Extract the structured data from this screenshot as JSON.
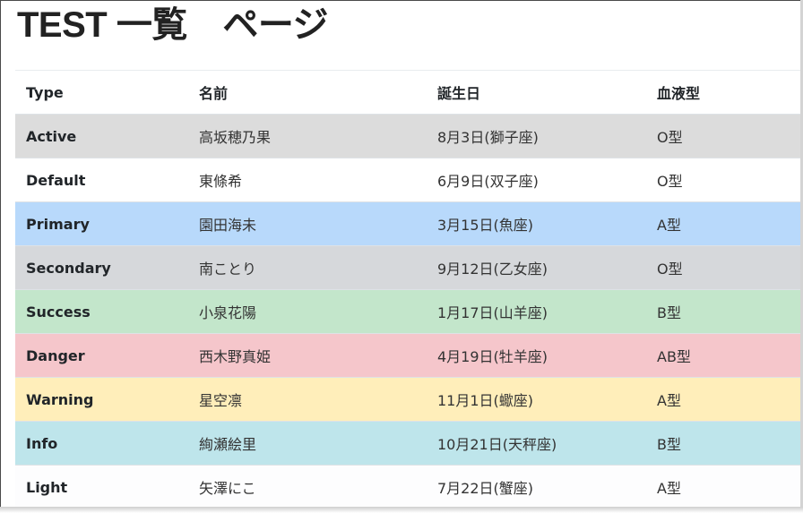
{
  "page": {
    "title": "TEST 一覧　ページ"
  },
  "table": {
    "headers": [
      "Type",
      "名前",
      "誕生日",
      "血液型"
    ],
    "rows": [
      {
        "type": "Active",
        "name": "高坂穂乃果",
        "birthday": "8月3日(獅子座)",
        "blood": "O型",
        "color": "#dcdcdc"
      },
      {
        "type": "Default",
        "name": "東條希",
        "birthday": "6月9日(双子座)",
        "blood": "O型",
        "color": "#ffffff"
      },
      {
        "type": "Primary",
        "name": "園田海未",
        "birthday": "3月15日(魚座)",
        "blood": "A型",
        "color": "#b8d9fb"
      },
      {
        "type": "Secondary",
        "name": "南ことり",
        "birthday": "9月12日(乙女座)",
        "blood": "O型",
        "color": "#d6d8db"
      },
      {
        "type": "Success",
        "name": "小泉花陽",
        "birthday": "1月17日(山羊座)",
        "blood": "B型",
        "color": "#c3e6cb"
      },
      {
        "type": "Danger",
        "name": "西木野真姫",
        "birthday": "4月19日(牡羊座)",
        "blood": "AB型",
        "color": "#f5c6cb"
      },
      {
        "type": "Warning",
        "name": "星空凛",
        "birthday": "11月1日(蠍座)",
        "blood": "A型",
        "color": "#ffeeba"
      },
      {
        "type": "Info",
        "name": "絢瀬絵里",
        "birthday": "10月21日(天秤座)",
        "blood": "B型",
        "color": "#bee5eb"
      },
      {
        "type": "Light",
        "name": "矢澤にこ",
        "birthday": "7月22日(蟹座)",
        "blood": "A型",
        "color": "#fdfdfe"
      }
    ]
  }
}
